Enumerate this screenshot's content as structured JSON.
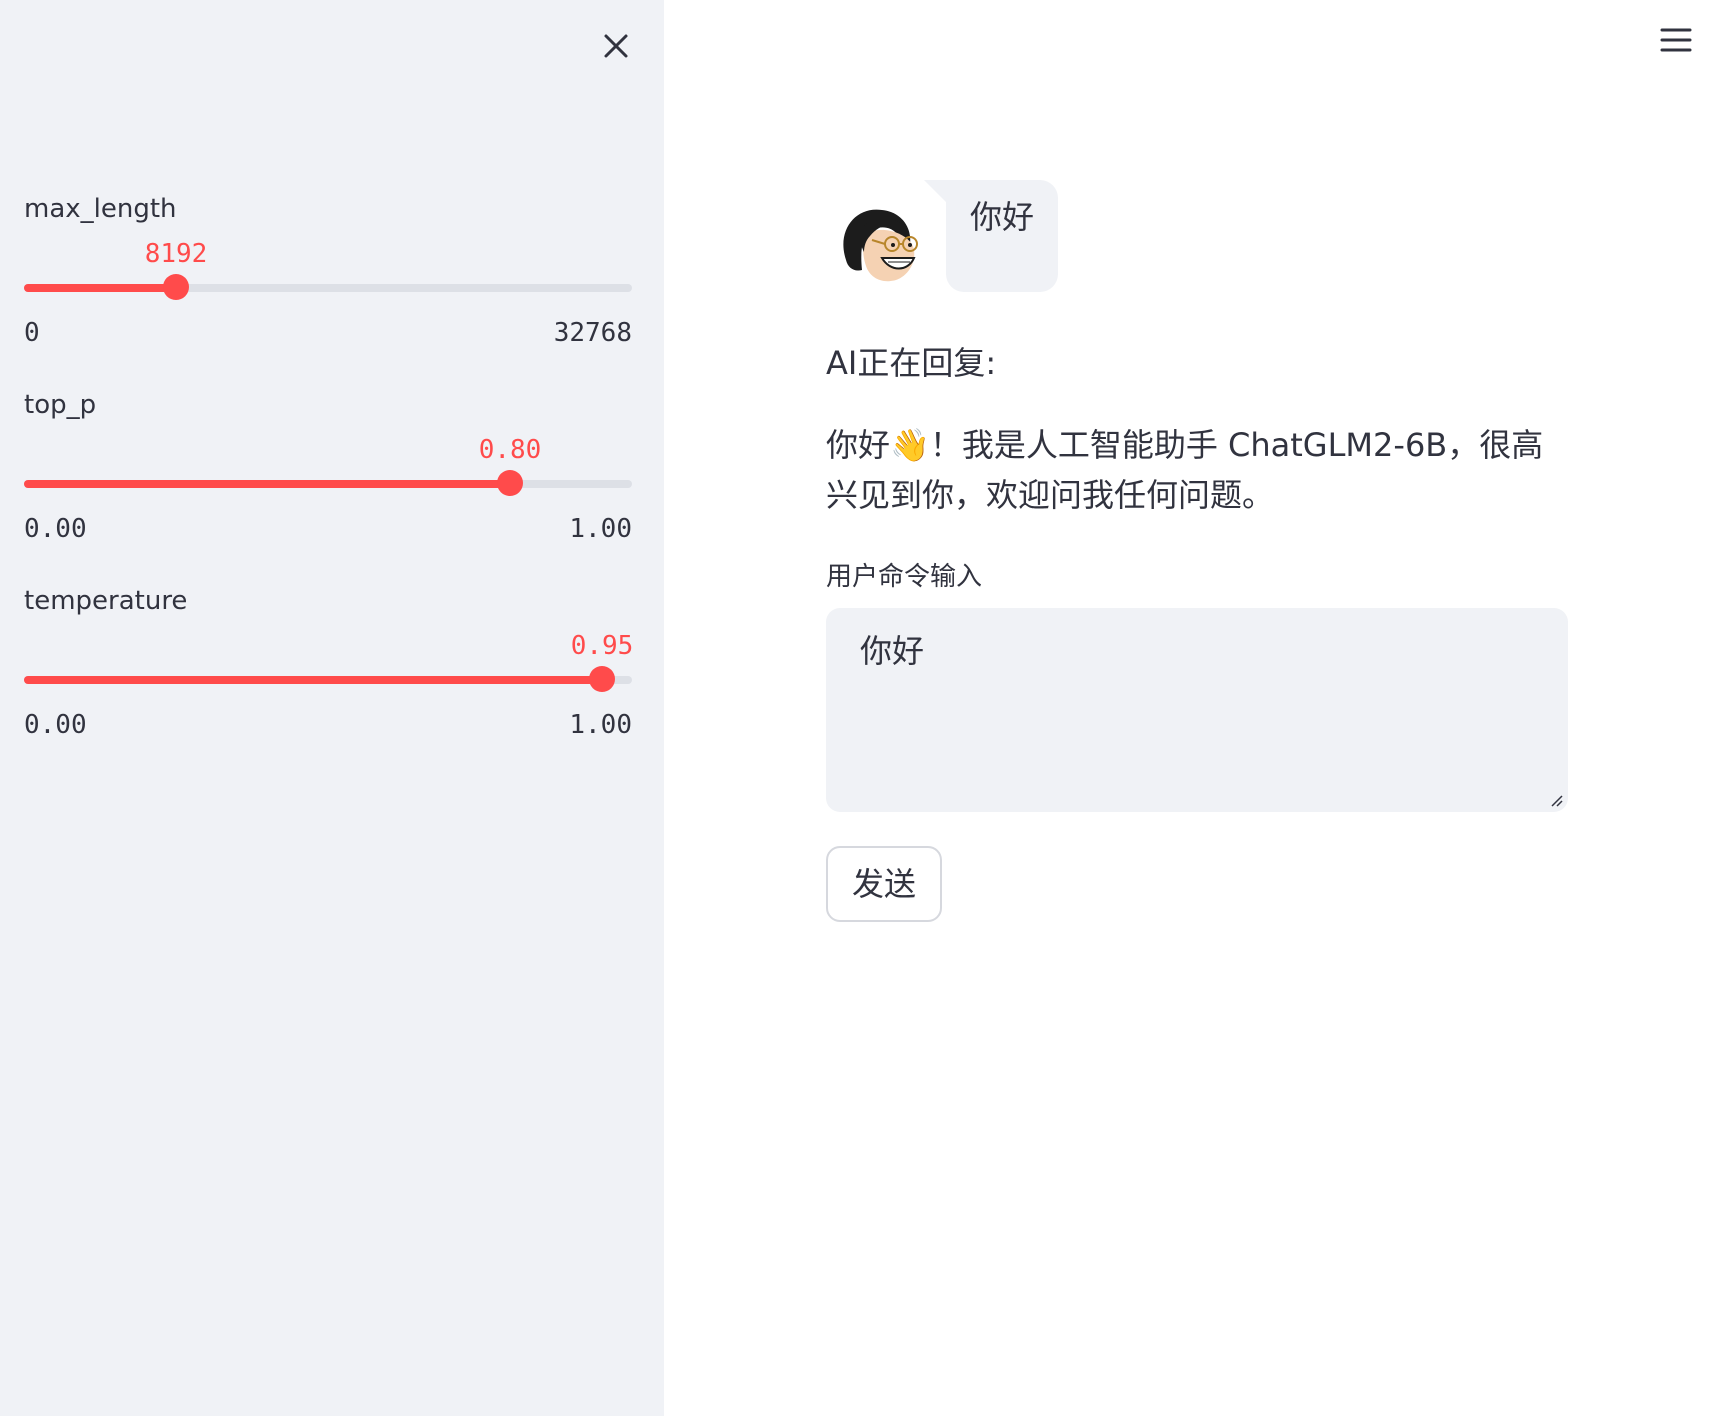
{
  "sidebar": {
    "close_icon": "close-icon",
    "sliders": [
      {
        "name": "max_length",
        "label": "max_length",
        "value": "8192",
        "min": "0",
        "max": "32768",
        "fraction": 0.25
      },
      {
        "name": "top_p",
        "label": "top_p",
        "value": "0.80",
        "min": "0.00",
        "max": "1.00",
        "fraction": 0.8
      },
      {
        "name": "temperature",
        "label": "temperature",
        "value": "0.95",
        "min": "0.00",
        "max": "1.00",
        "fraction": 0.95
      }
    ]
  },
  "header": {
    "menu_icon": "hamburger-menu-icon"
  },
  "chat": {
    "avatar_icon": "user-avatar-icon",
    "user_message": "你好",
    "ai_status": "AI正在回复:",
    "ai_reply": "你好👋！我是人工智能助手 ChatGLM2-6B，很高兴见到你，欢迎问我任何问题。"
  },
  "input": {
    "label": "用户命令输入",
    "value": "你好"
  },
  "send_button": {
    "label": "发送"
  },
  "colors": {
    "accent": "#ff4b4b",
    "sidebar_bg": "#f0f2f6",
    "track": "#dde0e6",
    "text": "#31333f"
  }
}
